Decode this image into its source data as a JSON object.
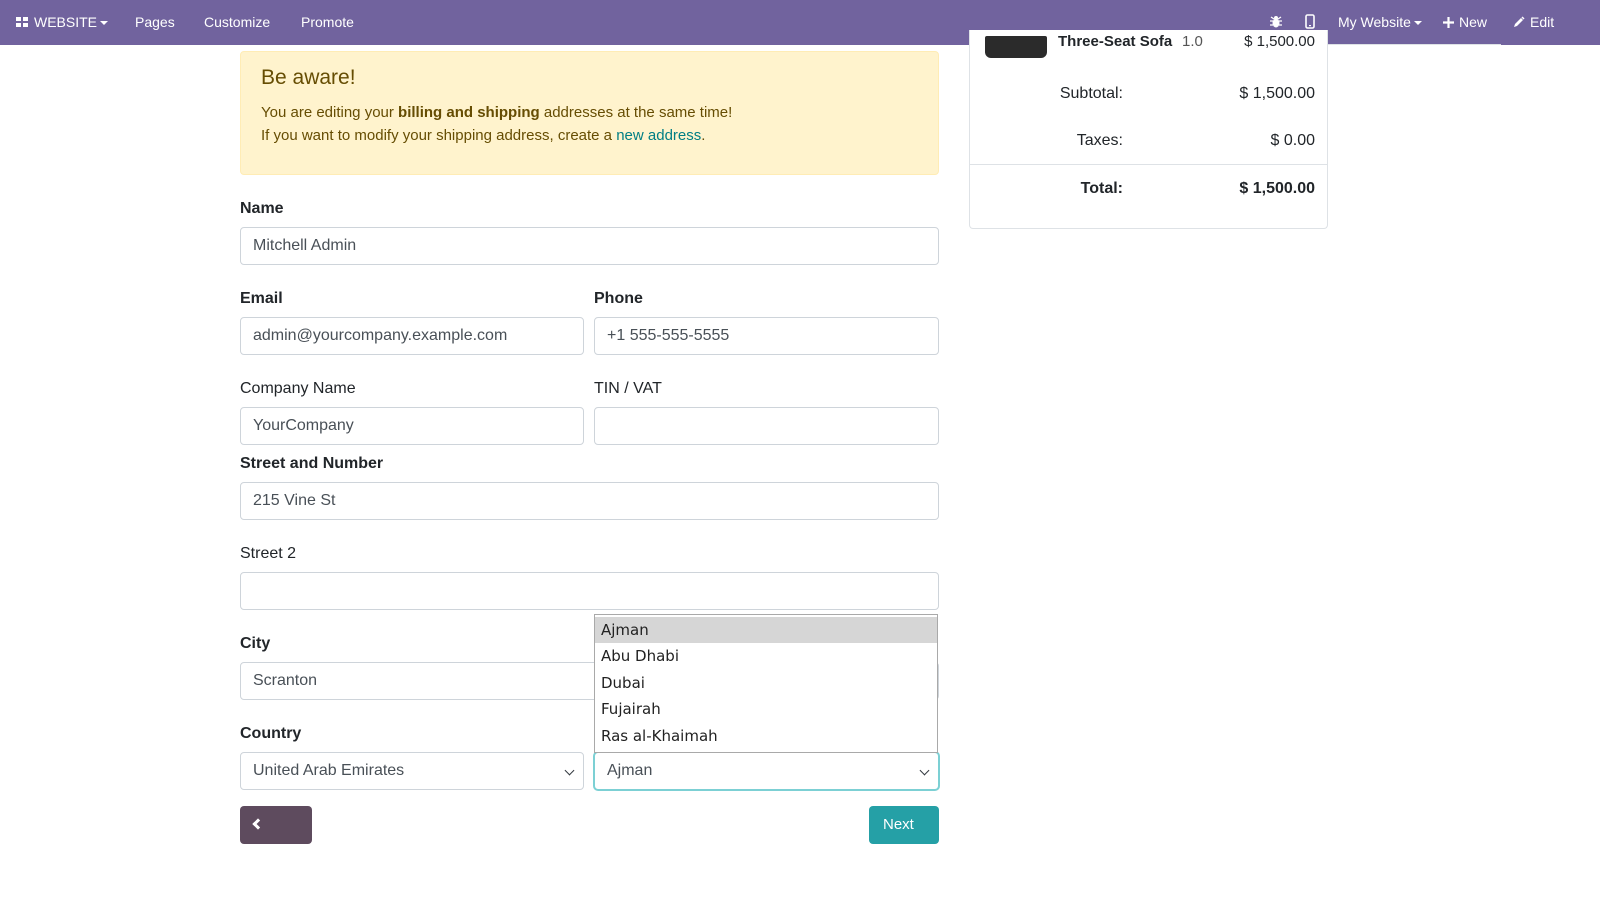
{
  "navbar": {
    "app_menu": "WEBSITE",
    "items": [
      "Pages",
      "Customize",
      "Promote"
    ],
    "website_selector": "My Website",
    "new_label": "New",
    "edit_label": "Edit"
  },
  "summary": {
    "product": "Three-Seat Sofa",
    "product_qty": "1.0",
    "product_price": "$ 1,500.00",
    "subtotal_label": "Subtotal:",
    "subtotal_value": "$ 1,500.00",
    "taxes_label": "Taxes:",
    "taxes_value": "$ 0.00",
    "total_label": "Total:",
    "total_value": "$ 1,500.00"
  },
  "alert": {
    "title": "Be aware!",
    "line1_pre": "You are editing your ",
    "line1_bold": "billing and shipping",
    "line1_post": " addresses at the same time!",
    "line2_pre": "If you want to modify your shipping address, create a ",
    "line2_link": "new address",
    "line2_post": "."
  },
  "form": {
    "name_label": "Name",
    "name_value": "Mitchell Admin",
    "email_label": "Email",
    "email_value": "admin@yourcompany.example.com",
    "phone_label": "Phone",
    "phone_value": "+1 555-555-5555",
    "company_label": "Company Name",
    "company_value": "YourCompany",
    "vat_label": "TIN / VAT",
    "vat_value": "",
    "street_label": "Street and Number",
    "street_value": "215 Vine St",
    "street2_label": "Street 2",
    "street2_value": "",
    "city_label": "City",
    "city_value": "Scranton",
    "country_label": "Country",
    "country_value": "United Arab Emirates",
    "state_value": "Ajman",
    "state_options": [
      "Ajman",
      "Abu Dhabi",
      "Dubai",
      "Fujairah",
      "Ras al-Khaimah"
    ]
  },
  "buttons": {
    "back": "Back",
    "next": "Next"
  },
  "colors": {
    "navbar": "#71639e",
    "alert_bg": "#fff3cd",
    "back_button": "#5e4b5e",
    "next_button": "#25a0a6"
  }
}
